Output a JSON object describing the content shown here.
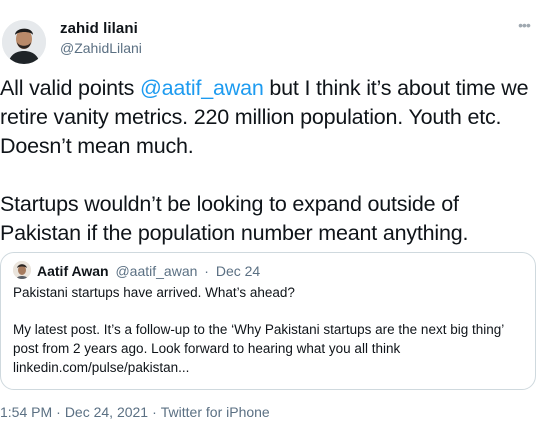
{
  "author": {
    "name": "zahid lilani",
    "handle": "@ZahidLilani"
  },
  "more_icon": "more-horizontal-icon",
  "body": {
    "p1_prefix": "All valid points ",
    "p1_mention": "@aatif_awan",
    "p1_suffix": " but I think it’s about time we retire vanity metrics. 220 million population. Youth etc. Doesn’t mean much.",
    "p2": "Startups wouldn’t be looking to expand outside of Pakistan if the population number meant anything."
  },
  "quote": {
    "name": "Aatif Awan",
    "handle": "@aatif_awan",
    "separator": "·",
    "date": "Dec 24",
    "line1": "Pakistani startups have arrived. What’s ahead?",
    "line2": "My latest post. It’s a follow-up to the ‘Why Pakistani startups are the next big thing’ post from 2 years ago. Look forward to hearing what you all think linkedin.com/pulse/pakistan..."
  },
  "footer": {
    "time": "1:54 PM",
    "separator": "·",
    "date": "Dec 24, 2021",
    "client": "Twitter for iPhone"
  },
  "colors": {
    "link": "#1d9bf0",
    "secondary_text": "#5b7083",
    "border": "#cfd9de"
  }
}
